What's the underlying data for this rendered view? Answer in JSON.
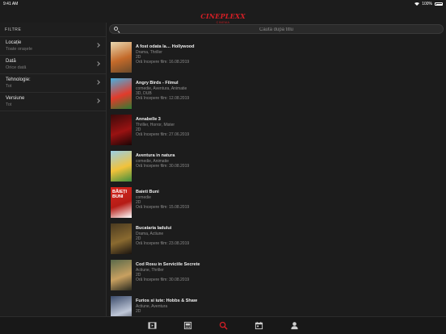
{
  "status": {
    "time": "9:41 AM",
    "battery": "100%"
  },
  "header": {
    "brand": "CINEPLEXX",
    "sub": "CINEMA"
  },
  "sidebar": {
    "title": "FILTRE",
    "filters": [
      {
        "label": "Locație",
        "value": "Toate orașele"
      },
      {
        "label": "Dată",
        "value": "Orice dată"
      },
      {
        "label": "Tehnologie:",
        "value": "Tot"
      },
      {
        "label": "Versiune",
        "value": "Tot"
      }
    ]
  },
  "search": {
    "placeholder": "Caută după titlu"
  },
  "movies": [
    {
      "title": "A fost odata la… Hollywood",
      "meta": [
        "Drama, Thriller",
        "2D",
        "Oră începere film: 16.08.2019"
      ]
    },
    {
      "title": "Angry Birds - Filmul",
      "meta": [
        "comedie, Aventura, Animatie",
        "3D, DUB",
        "Oră începere film: 12.08.2019"
      ]
    },
    {
      "title": "Annabelle 3",
      "meta": [
        "Thriller, Horror, Mister",
        "2D",
        "Oră începere film: 27.06.2019"
      ]
    },
    {
      "title": "Aventura in natura",
      "meta": [
        "comedie, Animatie",
        "Oră începere film: 30.08.2019"
      ]
    },
    {
      "title": "Baieti Buni",
      "meta": [
        "comedie",
        "2D",
        "Oră începere film: 15.08.2019"
      ]
    },
    {
      "title": "Bucataria Iadului",
      "meta": [
        "Drama, Actiune",
        "2D",
        "Oră începere film: 23.08.2019"
      ]
    },
    {
      "title": "Cod Rosu in Serviciile Secrete",
      "meta": [
        "Actiune, Thriller",
        "2D",
        "Oră începere film: 30.08.2019"
      ]
    },
    {
      "title": "Furios si iute: Hobbs & Shaw",
      "meta": [
        "Actiune, Aventura",
        "2D",
        ""
      ]
    }
  ],
  "posters": [
    {
      "text": "",
      "colors": [
        "#e8d8b0",
        "#c46a2a",
        "#6a4a2a"
      ]
    },
    {
      "text": "",
      "colors": [
        "#47b0e0",
        "#e23b2b",
        "#2e7d32"
      ]
    },
    {
      "text": "",
      "colors": [
        "#3a0a0a",
        "#9a1212",
        "#1a0505"
      ]
    },
    {
      "text": "",
      "colors": [
        "#9ad0e8",
        "#f2c23a",
        "#3e8e3e"
      ]
    },
    {
      "text": "BĂIEȚI BUNI",
      "colors": [
        "#d7261e",
        "#b51c16",
        "#ffffff"
      ]
    },
    {
      "text": "",
      "colors": [
        "#4a3a20",
        "#8a6a30",
        "#1a1410"
      ]
    },
    {
      "text": "",
      "colors": [
        "#5a6a4a",
        "#c8a060",
        "#2a2a20"
      ]
    },
    {
      "text": "",
      "colors": [
        "#3a4a6a",
        "#c0c8d8",
        "#1a2030"
      ]
    }
  ],
  "tabs": [
    {
      "name": "tab-films",
      "icon": "film-icon"
    },
    {
      "name": "tab-schedule",
      "icon": "cinema-schedule-icon"
    },
    {
      "name": "tab-search",
      "icon": "search-icon"
    },
    {
      "name": "tab-calendar",
      "icon": "calendar-icon"
    },
    {
      "name": "tab-profile",
      "icon": "profile-icon"
    }
  ],
  "colors": {
    "accent": "#d41f26",
    "background": "#1c1c1c",
    "muted": "#8d8d8d"
  }
}
